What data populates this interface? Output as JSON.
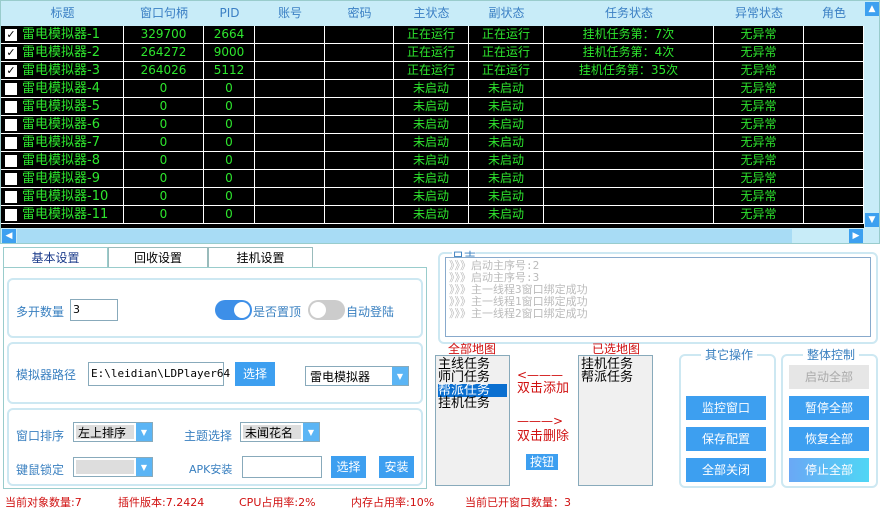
{
  "table": {
    "headers": [
      "标题",
      "窗口句柄",
      "PID",
      "账号",
      "密码",
      "主状态",
      "副状态",
      "任务状态",
      "异常状态",
      "角色"
    ],
    "rows": [
      {
        "checked": true,
        "title": "雷电模拟器-1",
        "handle": "329700",
        "pid": "2664",
        "account": "",
        "password": "",
        "main": "正在运行",
        "sub": "正在运行",
        "task": "挂机任务第：7次",
        "error": "无异常"
      },
      {
        "checked": true,
        "title": "雷电模拟器-2",
        "handle": "264272",
        "pid": "9000",
        "account": "",
        "password": "",
        "main": "正在运行",
        "sub": "正在运行",
        "task": "挂机任务第：4次",
        "error": "无异常"
      },
      {
        "checked": true,
        "title": "雷电模拟器-3",
        "handle": "264026",
        "pid": "5112",
        "account": "",
        "password": "",
        "main": "正在运行",
        "sub": "正在运行",
        "task": "挂机任务第：35次",
        "error": "无异常"
      },
      {
        "checked": false,
        "title": "雷电模拟器-4",
        "handle": "0",
        "pid": "0",
        "account": "",
        "password": "",
        "main": "未启动",
        "sub": "未启动",
        "task": "",
        "error": "无异常"
      },
      {
        "checked": false,
        "title": "雷电模拟器-5",
        "handle": "0",
        "pid": "0",
        "account": "",
        "password": "",
        "main": "未启动",
        "sub": "未启动",
        "task": "",
        "error": "无异常"
      },
      {
        "checked": false,
        "title": "雷电模拟器-6",
        "handle": "0",
        "pid": "0",
        "account": "",
        "password": "",
        "main": "未启动",
        "sub": "未启动",
        "task": "",
        "error": "无异常"
      },
      {
        "checked": false,
        "title": "雷电模拟器-7",
        "handle": "0",
        "pid": "0",
        "account": "",
        "password": "",
        "main": "未启动",
        "sub": "未启动",
        "task": "",
        "error": "无异常"
      },
      {
        "checked": false,
        "title": "雷电模拟器-8",
        "handle": "0",
        "pid": "0",
        "account": "",
        "password": "",
        "main": "未启动",
        "sub": "未启动",
        "task": "",
        "error": "无异常"
      },
      {
        "checked": false,
        "title": "雷电模拟器-9",
        "handle": "0",
        "pid": "0",
        "account": "",
        "password": "",
        "main": "未启动",
        "sub": "未启动",
        "task": "",
        "error": "无异常"
      },
      {
        "checked": false,
        "title": "雷电模拟器-10",
        "handle": "0",
        "pid": "0",
        "account": "",
        "password": "",
        "main": "未启动",
        "sub": "未启动",
        "task": "",
        "error": "无异常"
      },
      {
        "checked": false,
        "title": "雷电模拟器-11",
        "handle": "0",
        "pid": "0",
        "account": "",
        "password": "",
        "main": "未启动",
        "sub": "未启动",
        "task": "",
        "error": "无异常"
      }
    ]
  },
  "tabs": [
    "基本设置",
    "回收设置",
    "挂机设置"
  ],
  "basic": {
    "count_label": "多开数量",
    "count_value": "3",
    "topmost_label": "是否置顶",
    "topmost_on": true,
    "autologin_label": "自动登陆",
    "autologin_on": false,
    "path_label": "模拟器路径",
    "path_value": "E:\\leidian\\LDPlayer64",
    "path_select": "选择",
    "emulator_value": "雷电模拟器",
    "sort_label": "窗口排序",
    "sort_value": "左上排序",
    "theme_label": "主题选择",
    "theme_value": "未闻花名",
    "lock_label": "键鼠锁定",
    "lock_value": "",
    "apk_label": "APK安装",
    "apk_value": "",
    "apk_select": "选择",
    "apk_install": "安装"
  },
  "log": {
    "title": "日志",
    "lines": [
      "》》》启动主序号:2",
      "》》》启动主序号:3",
      "》》》主一线程3窗口绑定成功",
      "》》》主一线程1窗口绑定成功",
      "》》》主一线程2窗口绑定成功"
    ]
  },
  "maps": {
    "all_title": "全部地图",
    "all": [
      "主线任务",
      "师门任务",
      "帮派任务",
      "挂机任务"
    ],
    "all_selected": 2,
    "add_arrow": "<———",
    "add_label": "双击添加",
    "del_arrow": "———>",
    "del_label": "双击删除",
    "button": "按钮",
    "chosen_title": "已选地图",
    "chosen": [
      "挂机任务",
      "帮派任务"
    ]
  },
  "other": {
    "title": "其它操作",
    "buttons": [
      "监控窗口",
      "保存配置",
      "全部关闭"
    ]
  },
  "control": {
    "title": "整体控制",
    "buttons": [
      "启动全部",
      "暂停全部",
      "恢复全部",
      "停止全部"
    ]
  },
  "status": {
    "objects": "当前对象数量:7",
    "version": "插件版本:7.2424",
    "cpu": "CPU占用率:2%",
    "mem": "内存占用率:10%",
    "windows": "当前已开窗口数量：3"
  }
}
